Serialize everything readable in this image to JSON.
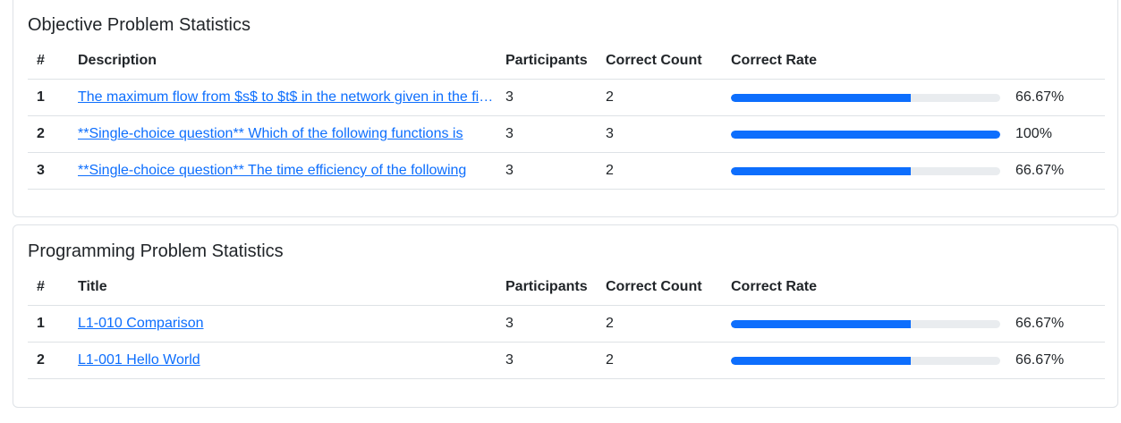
{
  "objective": {
    "title": "Objective Problem Statistics",
    "headers": {
      "num": "#",
      "description": "Description",
      "participants": "Participants",
      "correct_count": "Correct Count",
      "correct_rate": "Correct Rate"
    },
    "rows": [
      {
        "num": "1",
        "description": "The maximum flow from $s$ to $t$ in the network given in the figure below is",
        "participants": "3",
        "correct_count": "2",
        "rate": 0.6667,
        "rate_label": "66.67%"
      },
      {
        "num": "2",
        "description": "**Single-choice question** Which of the following functions is",
        "participants": "3",
        "correct_count": "3",
        "rate": 1.0,
        "rate_label": "100%"
      },
      {
        "num": "3",
        "description": "**Single-choice question** The time efficiency of the following",
        "participants": "3",
        "correct_count": "2",
        "rate": 0.6667,
        "rate_label": "66.67%"
      }
    ]
  },
  "programming": {
    "title": "Programming Problem Statistics",
    "headers": {
      "num": "#",
      "title": "Title",
      "participants": "Participants",
      "correct_count": "Correct Count",
      "correct_rate": "Correct Rate"
    },
    "rows": [
      {
        "num": "1",
        "title": "L1-010 Comparison",
        "participants": "3",
        "correct_count": "2",
        "rate": 0.6667,
        "rate_label": "66.67%"
      },
      {
        "num": "2",
        "title": "L1-001 Hello World",
        "participants": "3",
        "correct_count": "2",
        "rate": 0.6667,
        "rate_label": "66.67%"
      }
    ]
  },
  "colors": {
    "accent": "#0d6efd",
    "track": "#e9ecef",
    "border": "#dee2e6",
    "text": "#212529"
  }
}
